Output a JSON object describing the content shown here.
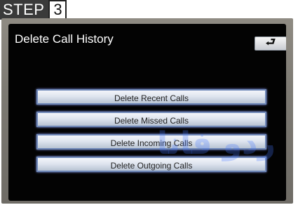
{
  "step": {
    "label": "STEP",
    "number": "3"
  },
  "screen": {
    "title": "Delete Call History"
  },
  "back_button": {
    "icon": "back-arrow-icon",
    "symbol": "⮐"
  },
  "menu": {
    "items": [
      {
        "label": "Delete Recent Calls"
      },
      {
        "label": "Delete Missed Calls"
      },
      {
        "label": "Delete Incoming Calls"
      },
      {
        "label": "Delete Outgoing Calls"
      }
    ]
  },
  "watermark": {
    "text": "ردو فانا"
  },
  "colors": {
    "screen_bg": "#030303",
    "button_border": "#6f88b8",
    "bezel": "#7f7b74"
  }
}
